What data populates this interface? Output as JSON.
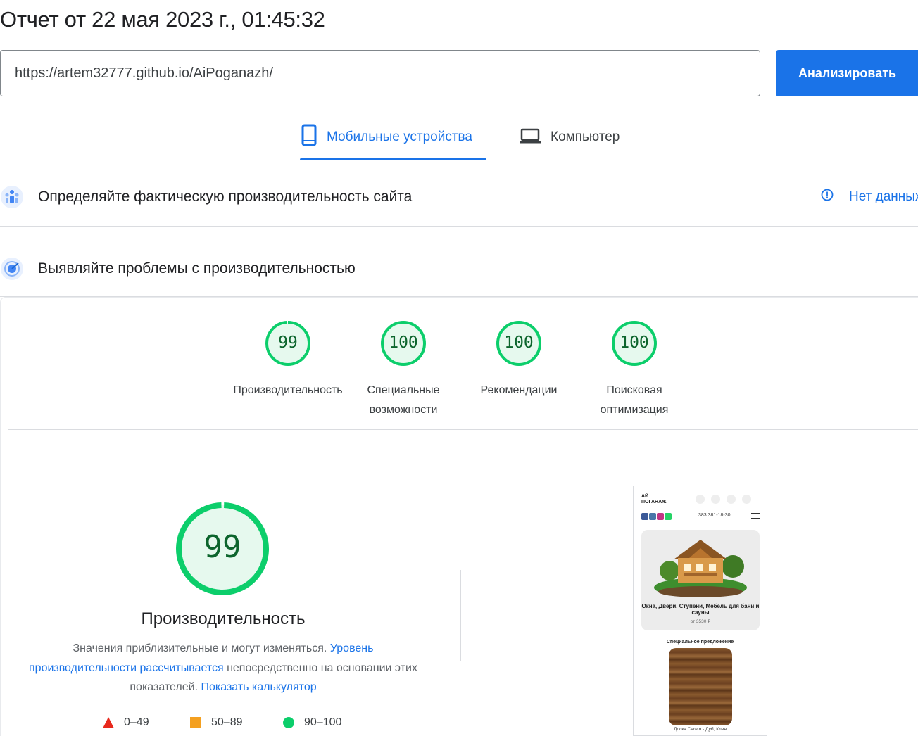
{
  "report": {
    "title": "Отчет от 22 мая 2023 г., 01:45:32"
  },
  "search": {
    "url": "https://artem32777.github.io/AiPoganazh/",
    "analyze_label": "Анализировать"
  },
  "tabs": [
    {
      "label": "Мобильные устройства",
      "icon": "smartphone-icon",
      "active": true
    },
    {
      "label": "Компьютер",
      "icon": "laptop-icon",
      "active": false
    }
  ],
  "field_data": {
    "title": "Определяйте фактическую производительность сайта",
    "status": "Нет данных",
    "icon": "field-data-icon"
  },
  "lab_data": {
    "title": "Выявляйте проблемы с производительностью",
    "icon": "diagnose-icon"
  },
  "categories": [
    {
      "score": "99",
      "label": "Производительность"
    },
    {
      "score": "100",
      "label": "Специальные возможности"
    },
    {
      "score": "100",
      "label": "Рекомендации"
    },
    {
      "score": "100",
      "label": "Поисковая оптимизация"
    }
  ],
  "performance": {
    "score": "99",
    "title": "Производительность",
    "desc_text_1": "Значения приблизительные и могут изменяться. ",
    "desc_link_1": "Уровень производительности рассчитывается",
    "desc_text_2": " непосредственно на основании этих показателей. ",
    "desc_link_2": "Показать калькулятор"
  },
  "legend": [
    {
      "range": "0–49",
      "color": "#e8291d",
      "shape": "triangle"
    },
    {
      "range": "50–89",
      "color": "#f4a020",
      "shape": "square"
    },
    {
      "range": "90–100",
      "color": "#0cce6b",
      "shape": "circle"
    }
  ],
  "screenshot": {
    "logo_line1": "АЙ",
    "logo_line2": "ПОГАНАЖ",
    "phone": "383 381-18-30",
    "hero_text": "Окна, Двери, Ступени, Мебель для бани и сауны",
    "hero_price": "от 3530 ₽",
    "offer_title": "Специальное предложение",
    "product_caption": "Доска Careto - Дуб, Клен"
  },
  "colors": {
    "accent": "#1a73e8",
    "pass": "#0cce6b",
    "pass_text": "#0d652d",
    "average": "#f4a020",
    "fail": "#e8291d"
  }
}
